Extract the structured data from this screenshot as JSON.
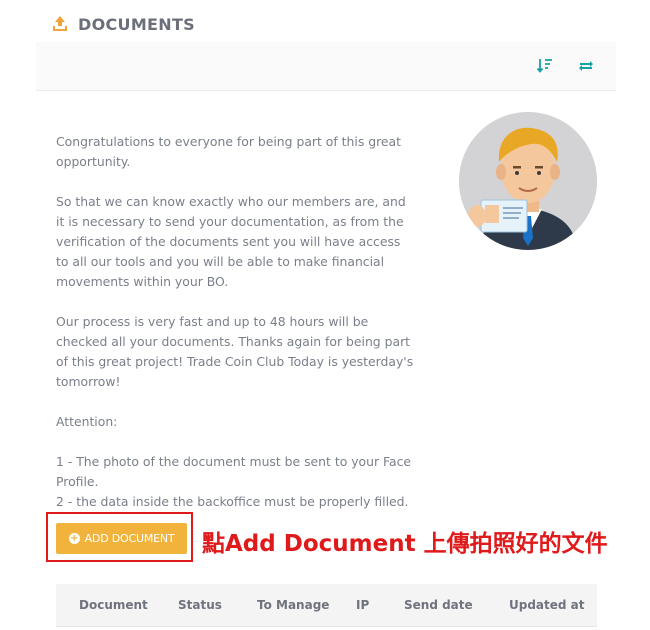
{
  "header": {
    "title": "DOCUMENTS",
    "icon": "upload-icon"
  },
  "toolbar": {
    "icons": [
      "sort-icon",
      "refresh-icon"
    ],
    "accent": "#17a2a2"
  },
  "content": {
    "p1": "Congratulations to everyone for being part of this great opportunity.",
    "p2": "So that we can know exactly who our members are, and it is necessary to send your documentation, as from the verification of the documents sent you will have access to all our tools and you will be able to make financial movements within your BO.",
    "p3": "Our process is very fast and up to 48 hours will be checked all your documents. Thanks again for being part of this great project! Trade Coin Club Today is yesterday's tomorrow!",
    "p4": "Attention:",
    "p5": "1 - The photo of the document must be sent to your Face Profile.",
    "p6": "2 - the data inside the backoffice must be properly filled."
  },
  "add_button": {
    "label": "ADD DOCUMENT",
    "color": "#f2b33d"
  },
  "annotation": {
    "text": "點Add Document 上傳拍照好的文件",
    "color": "#e0191b"
  },
  "table": {
    "columns": [
      "Document",
      "Status",
      "To Manage",
      "IP",
      "Send date",
      "Updated at"
    ]
  }
}
